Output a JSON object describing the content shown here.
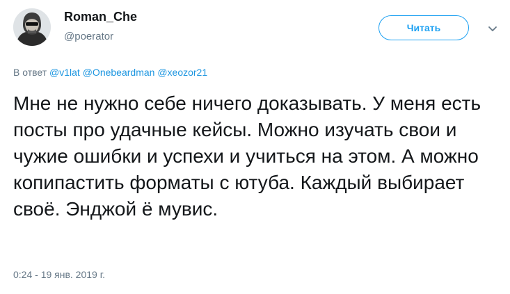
{
  "user": {
    "name": "Roman_Che",
    "handle": "@poerator"
  },
  "follow_button": {
    "label": "Читать"
  },
  "reply": {
    "prefix": "В ответ",
    "mentions": [
      "@v1lat",
      "@Onebeardman",
      "@xeozor21"
    ]
  },
  "tweet": {
    "text": "Мне не нужно себе ничего доказывать. У меня есть посты про удачные кейсы. Можно изучать свои и чужие ошибки и успехи и учиться на этом. А можно копипастить форматы с ютуба. Каждый выбирает своё. Энджой ё мувис.",
    "timestamp": "0:24 - 19 янв. 2019 г."
  },
  "colors": {
    "accent": "#1da1f2",
    "text": "#14171a",
    "secondary": "#657786"
  },
  "icons": {
    "menu": "chevron-down-icon"
  }
}
